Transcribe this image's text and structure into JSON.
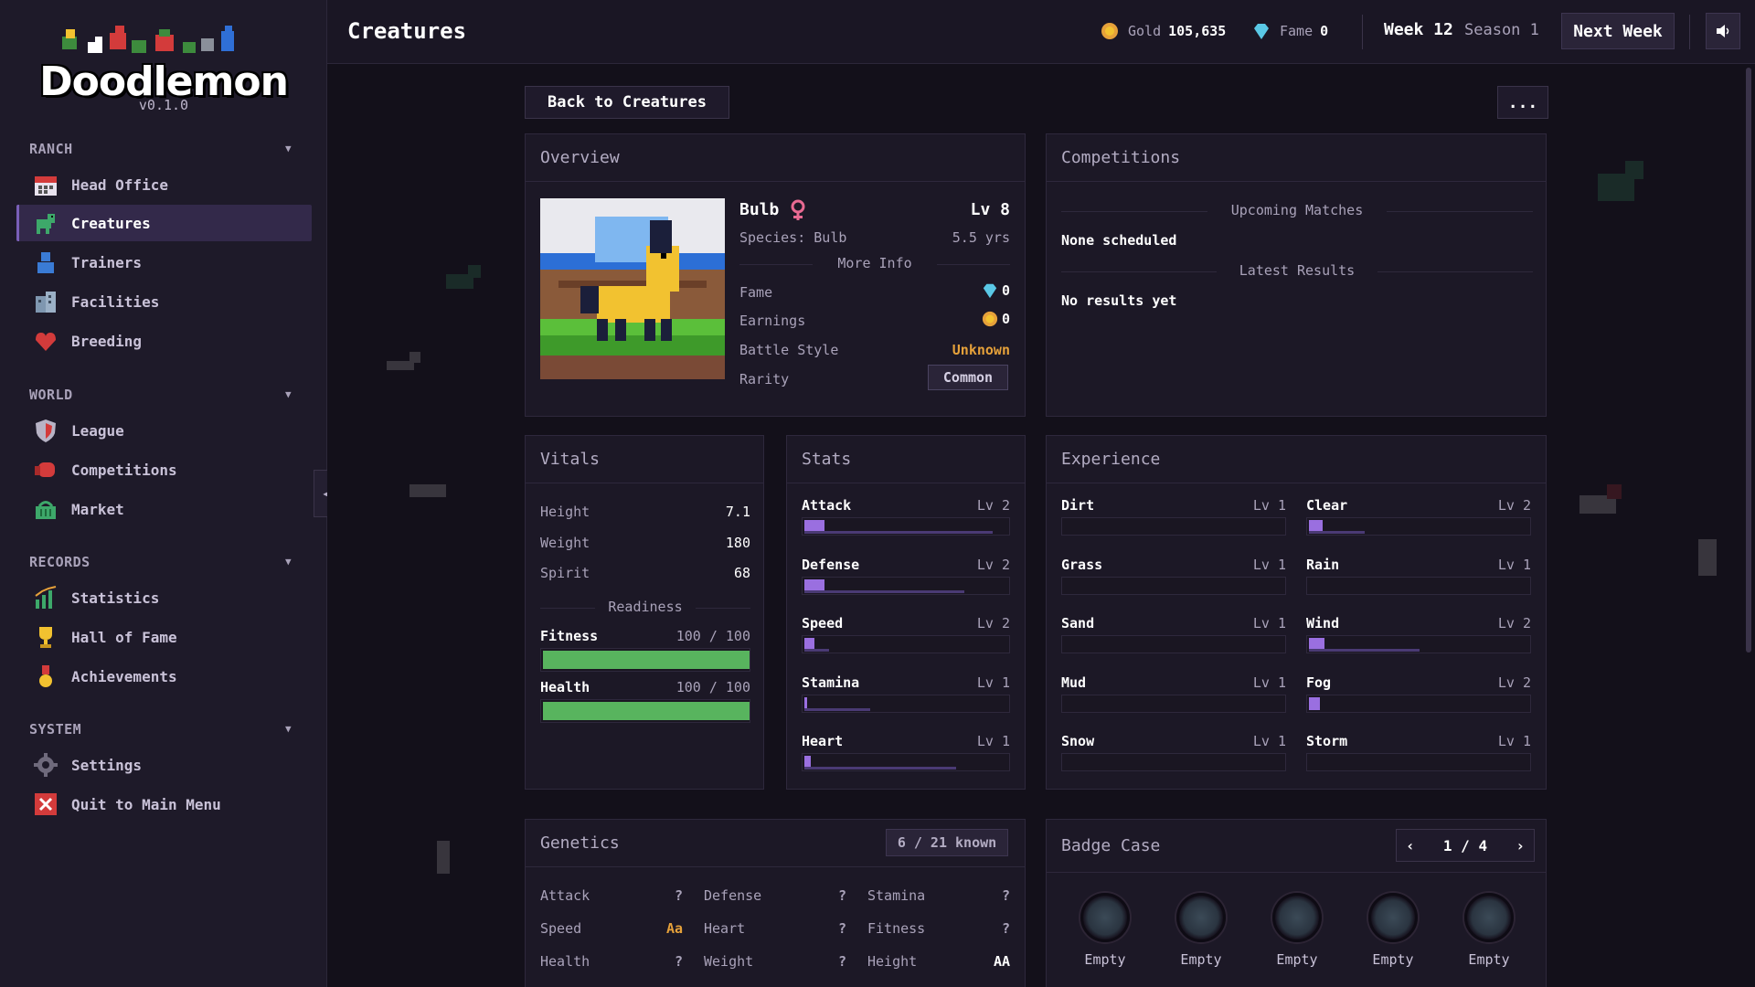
{
  "app": {
    "name": "Doodlemon",
    "version": "v0.1.0"
  },
  "sidebar": {
    "sections": [
      {
        "title": "RANCH",
        "items": [
          {
            "label": "Head Office",
            "icon": "calendar-icon"
          },
          {
            "label": "Creatures",
            "icon": "creature-icon",
            "active": true
          },
          {
            "label": "Trainers",
            "icon": "trainer-icon"
          },
          {
            "label": "Facilities",
            "icon": "building-icon"
          },
          {
            "label": "Breeding",
            "icon": "heart-icon"
          }
        ]
      },
      {
        "title": "WORLD",
        "items": [
          {
            "label": "League",
            "icon": "shield-icon"
          },
          {
            "label": "Competitions",
            "icon": "boxing-glove-icon"
          },
          {
            "label": "Market",
            "icon": "basket-icon"
          }
        ]
      },
      {
        "title": "RECORDS",
        "items": [
          {
            "label": "Statistics",
            "icon": "chart-icon"
          },
          {
            "label": "Hall of Fame",
            "icon": "trophy-icon"
          },
          {
            "label": "Achievements",
            "icon": "medal-icon"
          }
        ]
      },
      {
        "title": "SYSTEM",
        "items": [
          {
            "label": "Settings",
            "icon": "gear-icon"
          },
          {
            "label": "Quit to Main Menu",
            "icon": "close-icon"
          }
        ]
      }
    ]
  },
  "header": {
    "title": "Creatures",
    "gold_label": "Gold",
    "gold_value": "105,635",
    "fame_label": "Fame",
    "fame_value": "0",
    "week": "Week 12",
    "season": "Season 1",
    "next_week": "Next Week"
  },
  "toolbar": {
    "back": "Back to Creatures",
    "more": "..."
  },
  "overview": {
    "title": "Overview",
    "name": "Bulb",
    "level": "Lv 8",
    "species": "Species: Bulb",
    "age": "5.5 yrs",
    "more_info": "More Info",
    "fame_label": "Fame",
    "fame_value": "0",
    "earnings_label": "Earnings",
    "earnings_value": "0",
    "battle_label": "Battle Style",
    "battle_value": "Unknown",
    "rarity_label": "Rarity",
    "rarity_value": "Common"
  },
  "competitions": {
    "title": "Competitions",
    "upcoming_title": "Upcoming Matches",
    "upcoming_value": "None scheduled",
    "latest_title": "Latest Results",
    "latest_value": "No results yet"
  },
  "vitals": {
    "title": "Vitals",
    "rows": [
      {
        "label": "Height",
        "value": "7.1"
      },
      {
        "label": "Weight",
        "value": "180"
      },
      {
        "label": "Spirit",
        "value": "68"
      }
    ],
    "readiness": "Readiness",
    "fitness_label": "Fitness",
    "fitness_value": "100 / 100",
    "fitness_fraction": 1.0,
    "health_label": "Health",
    "health_value": "100 / 100",
    "health_fraction": 1.0
  },
  "stats": {
    "title": "Stats",
    "items": [
      {
        "label": "Attack",
        "level": "Lv 2",
        "progress": 0.1,
        "xp": 0.92
      },
      {
        "label": "Defense",
        "level": "Lv 2",
        "progress": 0.1,
        "xp": 0.78
      },
      {
        "label": "Speed",
        "level": "Lv 2",
        "progress": 0.05,
        "xp": 0.12
      },
      {
        "label": "Stamina",
        "level": "Lv 1",
        "progress": 0.01,
        "xp": 0.32
      },
      {
        "label": "Heart",
        "level": "Lv 1",
        "progress": 0.03,
        "xp": 0.74
      }
    ]
  },
  "experience": {
    "title": "Experience",
    "items": [
      {
        "label": "Dirt",
        "level": "Lv 1",
        "progress": 0,
        "xp": 0
      },
      {
        "label": "Clear",
        "level": "Lv 2",
        "progress": 0.06,
        "xp": 0.25
      },
      {
        "label": "Grass",
        "level": "Lv 1",
        "progress": 0,
        "xp": 0
      },
      {
        "label": "Rain",
        "level": "Lv 1",
        "progress": 0,
        "xp": 0
      },
      {
        "label": "Sand",
        "level": "Lv 1",
        "progress": 0,
        "xp": 0
      },
      {
        "label": "Wind",
        "level": "Lv 2",
        "progress": 0.07,
        "xp": 0.5
      },
      {
        "label": "Mud",
        "level": "Lv 1",
        "progress": 0,
        "xp": 0
      },
      {
        "label": "Fog",
        "level": "Lv 2",
        "progress": 0.05,
        "xp": 0
      },
      {
        "label": "Snow",
        "level": "Lv 1",
        "progress": 0,
        "xp": 0
      },
      {
        "label": "Storm",
        "level": "Lv 1",
        "progress": 0,
        "xp": 0
      }
    ]
  },
  "genetics": {
    "title": "Genetics",
    "known": "6 / 21 known",
    "items": [
      {
        "label": "Attack",
        "value": "?"
      },
      {
        "label": "Defense",
        "value": "?"
      },
      {
        "label": "Stamina",
        "value": "?"
      },
      {
        "label": "Speed",
        "value": "Aa",
        "highlight": "#e6a13a"
      },
      {
        "label": "Heart",
        "value": "?"
      },
      {
        "label": "Fitness",
        "value": "?"
      },
      {
        "label": "Health",
        "value": "?"
      },
      {
        "label": "Weight",
        "value": "?"
      },
      {
        "label": "Height",
        "value": "AA",
        "highlight": "#ffffff"
      }
    ]
  },
  "badges": {
    "title": "Badge Case",
    "page": "1 / 4",
    "prev": "‹",
    "next": "›",
    "slots": [
      "Empty",
      "Empty",
      "Empty",
      "Empty",
      "Empty"
    ]
  },
  "colors": {
    "accent": "#9a6fe0",
    "gold": "#e6a13a",
    "health": "#58b45e",
    "fame": "#5ac8e6",
    "female": "#e86a92"
  }
}
